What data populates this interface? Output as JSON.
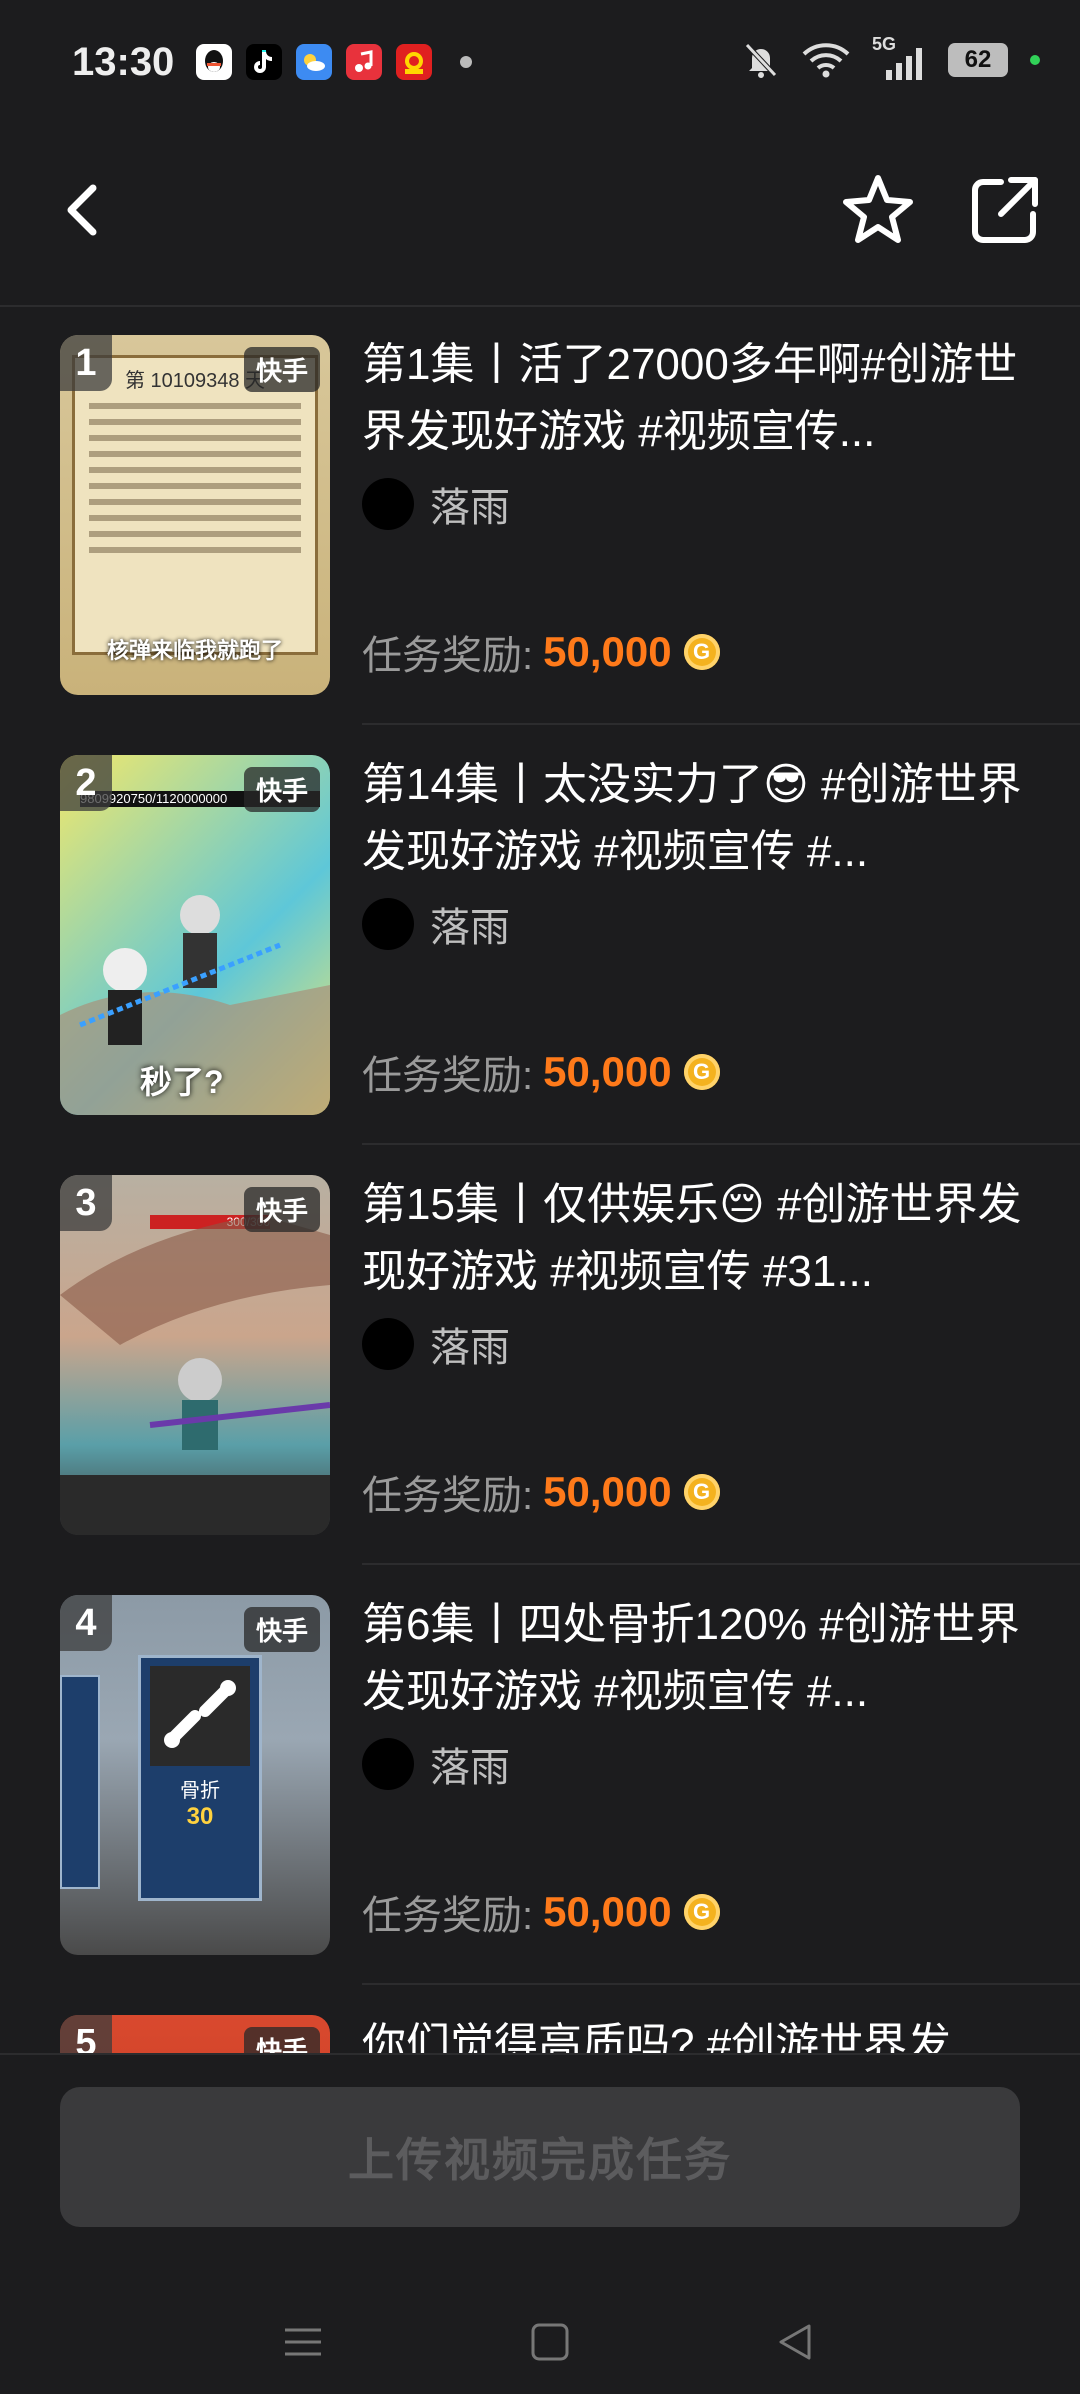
{
  "status_bar": {
    "time": "13:30",
    "app_icons": [
      "qq-icon",
      "douyin-icon",
      "weather-icon",
      "music-icon",
      "shopping-icon"
    ],
    "network": "5G",
    "battery": "62"
  },
  "header": {
    "back_icon": "chevron-left-icon",
    "favorite_icon": "star-icon",
    "share_icon": "share-icon"
  },
  "items": [
    {
      "rank": "1",
      "platform": "快手",
      "thumb_text": "第 10109348 天",
      "thumb_caption": "核弹来临我就跑了",
      "title": "第1集丨活了27000多年啊#创游世界发现好游戏 #视频宣传...",
      "author": "落雨",
      "reward_label": "任务奖励:",
      "reward_value": "50,000"
    },
    {
      "rank": "2",
      "platform": "快手",
      "thumb_text": "9809920750/1120000000",
      "thumb_caption": "秒了?",
      "title": "第14集丨太没实力了😎 #创游世界发现好游戏 #视频宣传 #...",
      "author": "落雨",
      "reward_label": "任务奖励:",
      "reward_value": "50,000"
    },
    {
      "rank": "3",
      "platform": "快手",
      "thumb_text": "300/300",
      "thumb_caption": "",
      "title": "第15集丨仅供娱乐😔 #创游世界发现好游戏 #视频宣传 #31...",
      "author": "落雨",
      "reward_label": "任务奖励:",
      "reward_value": "50,000"
    },
    {
      "rank": "4",
      "platform": "快手",
      "thumb_text": "骨折",
      "thumb_caption": "30",
      "title": "第6集丨四处骨折120% #创游世界发现好游戏 #视频宣传 #...",
      "author": "落雨",
      "reward_label": "任务奖励:",
      "reward_value": "50,000"
    },
    {
      "rank": "5",
      "platform": "快手",
      "thumb_text": "",
      "thumb_caption": "",
      "title": "你们觉得高质吗? #创游世界发",
      "author": "",
      "reward_label": "",
      "reward_value": ""
    }
  ],
  "upload_button": "上传视频完成任务",
  "nav_bar": {
    "menu_icon": "menu-icon",
    "home_icon": "home-icon",
    "back_icon": "back-triangle-icon"
  },
  "colors": {
    "background": "#1c1c1e",
    "reward_accent": "#ff7a1a",
    "coin": "#f4b21f",
    "button_bg": "#3a3a3c",
    "button_text": "#5c5c5e"
  }
}
